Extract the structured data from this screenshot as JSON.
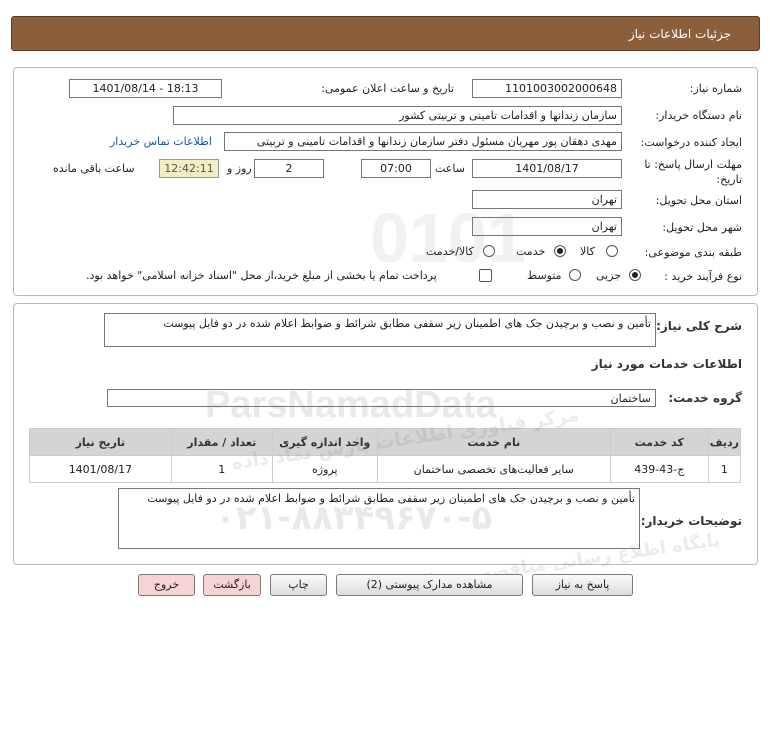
{
  "header": {
    "title": "جزئیات اطلاعات نیاز"
  },
  "form": {
    "need_number_label": "شماره نیاز:",
    "need_number": "1101003002000648",
    "announce_label": "تاریخ و ساعت اعلان عمومی:",
    "announce_value": "1401/08/14 - 18:13",
    "buyer_org_label": "نام دستگاه خریدار:",
    "buyer_org": "سازمان زندانها و اقدامات تامینی و تربیتی کشور",
    "creator_label": "ایجاد کننده درخواست:",
    "creator": "مهدی  دهقان پور مهریان مسئول دفتر سازمان زندانها و اقدامات تامینی و تربیتی",
    "contact_link": "اطلاعات تماس خریدار",
    "deadline_label": "مهلت ارسال پاسخ: تا تاریخ:",
    "deadline_date": "1401/08/17",
    "time_label": "ساعت",
    "deadline_time": "07:00",
    "days_value": "2",
    "days_label": "روز و",
    "remaining_time": "12:42:11",
    "remaining_label": "ساعت باقی مانده",
    "province_label": "استان محل تحویل:",
    "province": "تهران",
    "city_label": "شهر محل تحویل:",
    "city": "تهران",
    "category_label": "طبقه بندی موضوعی:",
    "category_options": [
      "کالا",
      "خدمت",
      "کالا/خدمت"
    ],
    "category_selected": "خدمت",
    "purchase_label": "نوع فرآیند خرید :",
    "purchase_options": [
      "جزیی",
      "متوسط"
    ],
    "purchase_selected": "جزیی",
    "payment_note": "پرداخت تمام یا بخشی از مبلغ خرید،از محل \"اسناد خزانه اسلامی\" خواهد بود."
  },
  "summary": {
    "label": "شرح کلی نیاز:",
    "text": "تأمین و نصب و برچیدن جک های اطمینان زیر سقفی مطابق شرائط و ضوابط اعلام شده در دو فایل پیوست",
    "services_heading": "اطلاعات خدمات مورد نیاز",
    "group_label": "گروه خدمت:",
    "group_value": "ساختمان"
  },
  "table": {
    "headers": [
      "ردیف",
      "کد خدمت",
      "نام خدمت",
      "واحد اندازه گیری",
      "تعداد / مقدار",
      "تاریخ نیاز"
    ],
    "rows": [
      [
        "1",
        "ج-43-439",
        "سایر فعالیت‌های تخصصی ساختمان",
        "پروژه",
        "1",
        "1401/08/17"
      ]
    ]
  },
  "buyer_notes": {
    "label": "توضیحات خریدار:",
    "text": "تأمین و نصب و برچیدن جک های اطمینان زیر سقفی مطابق شرائط و ضوابط اعلام شده در دو فایل پیوست"
  },
  "buttons": {
    "reply": "پاسخ به نیاز",
    "attachments": "مشاهده مدارک پیوستی (2)",
    "print": "چاپ",
    "back": "بازگشت",
    "exit": "خروج"
  },
  "watermark": {
    "brand": "ParsNamadData",
    "line1": "مرکز فناوری اطلاعات پارس نماد داده",
    "line2": "پایگاه اطلاع رسانی مناقصه و مزایده",
    "phone": "۰۲۱-۸۸۳۴۹۶۷۰-۵"
  },
  "colors": {
    "header": "#8b5e3c",
    "link": "#1a52b0",
    "table_header": "#d4d4d4",
    "pink_button": "#f8d3d3",
    "remaining_bg": "#f3edc4"
  }
}
